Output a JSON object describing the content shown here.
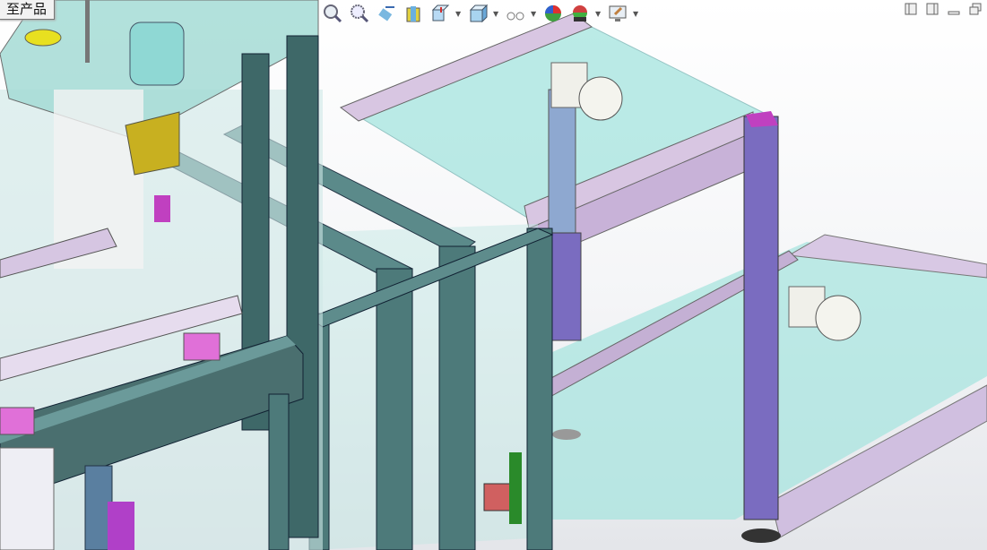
{
  "viewport": {
    "model_label": "至产品"
  },
  "heads_up_toolbar": {
    "tools": [
      {
        "name": "zoom-to-fit",
        "icon": "zoom-fit-icon"
      },
      {
        "name": "zoom-to-area",
        "icon": "zoom-area-icon"
      },
      {
        "name": "previous-view",
        "icon": "previous-view-icon"
      },
      {
        "name": "section-view",
        "icon": "section-view-icon"
      },
      {
        "name": "view-orientation",
        "icon": "view-orientation-icon",
        "dropdown": true
      },
      {
        "name": "display-style",
        "icon": "display-style-icon",
        "dropdown": true
      },
      {
        "name": "hide-show-items",
        "icon": "hide-show-icon",
        "dropdown": true
      },
      {
        "name": "edit-appearance",
        "icon": "appearance-icon"
      },
      {
        "name": "apply-scene",
        "icon": "scene-icon",
        "dropdown": true
      },
      {
        "name": "view-settings",
        "icon": "view-settings-icon",
        "dropdown": true
      }
    ]
  },
  "window_controls": [
    "split-left-icon",
    "split-right-icon",
    "minimize-icon",
    "restore-icon"
  ],
  "colors": {
    "glass": "#8fe0da",
    "frame_lavender": "#d8c4e4",
    "frame_teal": "#4d7a7a",
    "post_purple": "#7a6cc0",
    "motor_yellow": "#c8b020"
  }
}
